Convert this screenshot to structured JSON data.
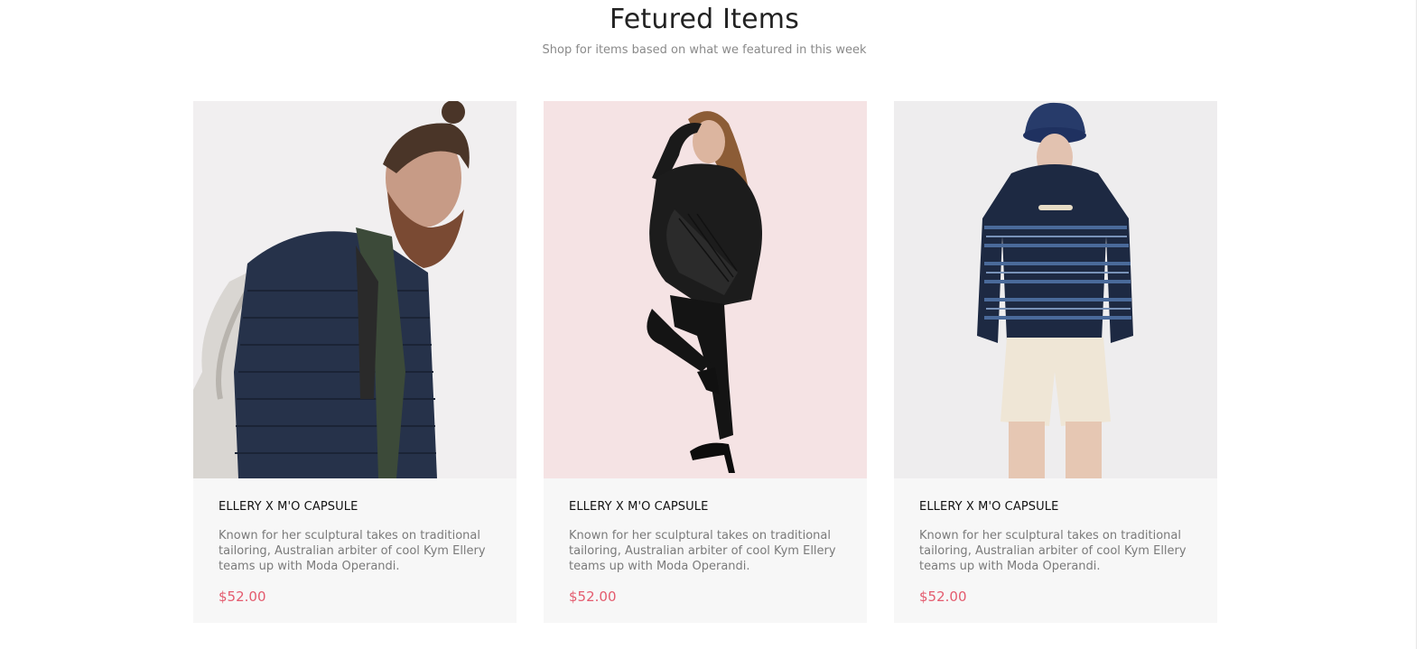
{
  "section": {
    "title": "Fetured Items",
    "subtitle": "Shop for items based on what we featured in this week"
  },
  "products": [
    {
      "title": "ELLERY X M'O CAPSULE",
      "description": "Known for her sculptural takes on traditional tailoring, Australian arbiter of cool Kym Ellery teams up with Moda Operandi.",
      "price": "$52.00",
      "image_bg": "#f1eff0"
    },
    {
      "title": "ELLERY X M'O CAPSULE",
      "description": "Known for her sculptural takes on traditional tailoring, Australian arbiter of cool Kym Ellery teams up with Moda Operandi.",
      "price": "$52.00",
      "image_bg": "#f5e3e4"
    },
    {
      "title": "ELLERY X M'O CAPSULE",
      "description": "Known for her sculptural takes on traditional tailoring, Australian arbiter of cool Kym Ellery teams up with Moda Operandi.",
      "price": "$52.00",
      "image_bg": "#eeedee"
    }
  ],
  "colors": {
    "price": "#e45b6e",
    "card_bg": "#f7f7f7"
  }
}
